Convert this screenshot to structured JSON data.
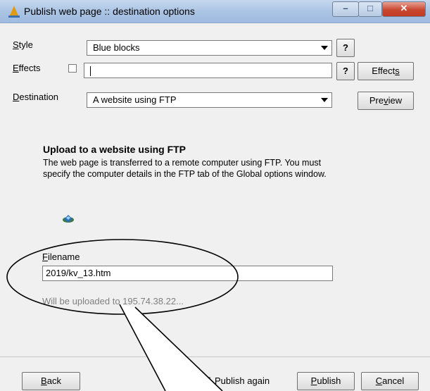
{
  "window": {
    "title": "Publish web page :: destination options"
  },
  "style": {
    "label": "Style",
    "value": "Blue blocks"
  },
  "effects": {
    "label": "Effects",
    "value": "",
    "button": "Effects"
  },
  "destination": {
    "label": "Destination",
    "value": "A website using FTP"
  },
  "help_button": "?",
  "preview_button": "Preview",
  "info": {
    "heading": "Upload to a website using FTP",
    "description": "The web page is transferred to a remote computer using FTP.  You must specify the computer details in the FTP tab of the Global options window."
  },
  "filename": {
    "label": "Filename",
    "value": "2019/kv_13.htm",
    "upload_note": "Will be uploaded to 195.74.38.22..."
  },
  "footer": {
    "back": "Back",
    "publish_again": "Publish again",
    "publish": "Publish",
    "cancel": "Cancel"
  }
}
